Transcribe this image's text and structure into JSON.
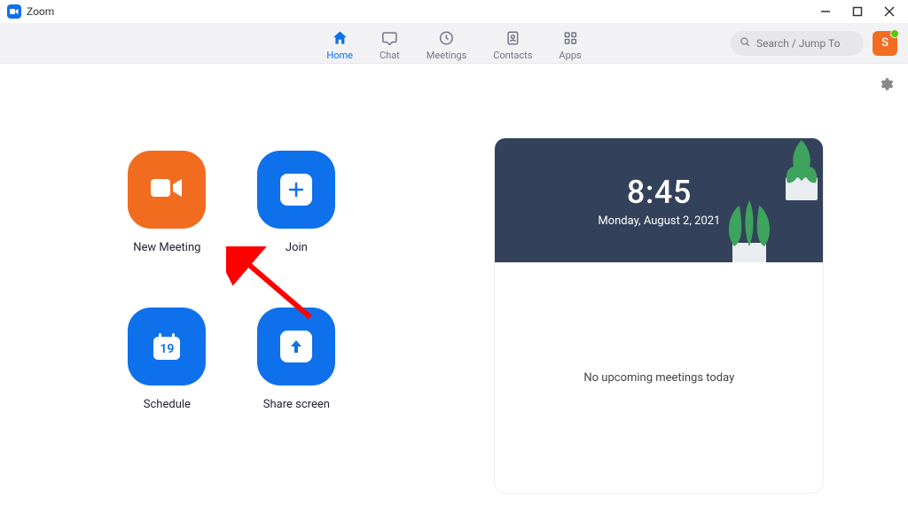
{
  "titlebar": {
    "title": "Zoom"
  },
  "nav": {
    "tabs": [
      {
        "label": "Home"
      },
      {
        "label": "Chat"
      },
      {
        "label": "Meetings"
      },
      {
        "label": "Contacts"
      },
      {
        "label": "Apps"
      }
    ],
    "search_placeholder": "Search / Jump To",
    "avatar_initial": "S"
  },
  "actions": {
    "new_meeting": "New Meeting",
    "join": "Join",
    "schedule": "Schedule",
    "schedule_day": "19",
    "share_screen": "Share screen"
  },
  "card": {
    "time": "8:45",
    "date": "Monday, August 2, 2021",
    "empty_text": "No upcoming meetings today"
  }
}
